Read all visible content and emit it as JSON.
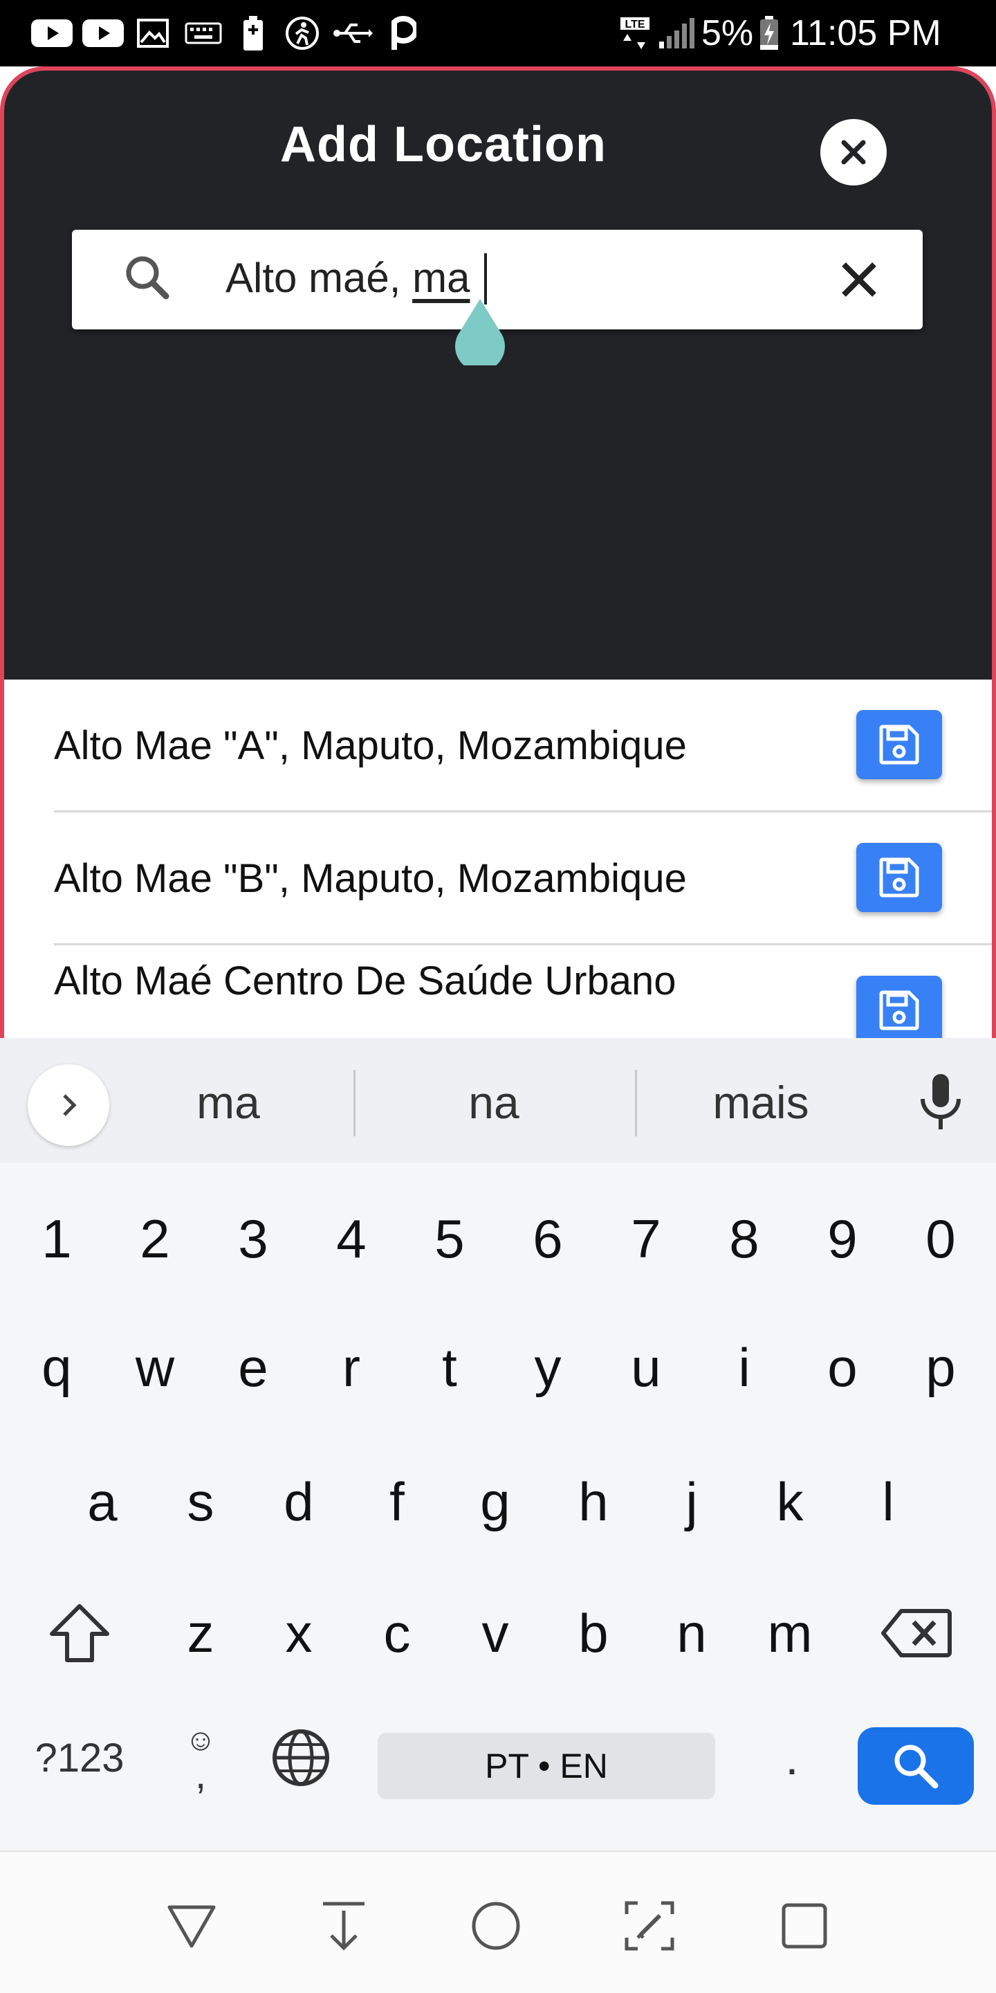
{
  "status_bar": {
    "battery_percent": "5%",
    "time": "11:05 PM",
    "network": "LTE"
  },
  "modal": {
    "title": "Add Location",
    "close_icon": "close-icon"
  },
  "search": {
    "query_prefix": "Alto maé, ",
    "query_underlined": "ma",
    "search_icon": "search-icon",
    "clear_icon": "clear-icon"
  },
  "results": [
    {
      "label": "Alto Mae \"A\", Maputo, Mozambique",
      "action_icon": "save-icon"
    },
    {
      "label": "Alto Mae \"B\", Maputo, Mozambique",
      "action_icon": "save-icon"
    },
    {
      "label": "Alto Maé Centro De Saúde Urbano",
      "action_icon": "save-icon"
    }
  ],
  "keyboard": {
    "suggestions": [
      "ma",
      "na",
      "mais"
    ],
    "number_row": [
      "1",
      "2",
      "3",
      "4",
      "5",
      "6",
      "7",
      "8",
      "9",
      "0"
    ],
    "row1": [
      "q",
      "w",
      "e",
      "r",
      "t",
      "y",
      "u",
      "i",
      "o",
      "p"
    ],
    "row2": [
      "a",
      "s",
      "d",
      "f",
      "g",
      "h",
      "j",
      "k",
      "l"
    ],
    "row3": [
      "z",
      "x",
      "c",
      "v",
      "b",
      "n",
      "m"
    ],
    "symbols_label": "?123",
    "emoji_label": "☺",
    "comma_label": ",",
    "space_label": "PT • EN",
    "period_label": "."
  },
  "colors": {
    "modal_border": "#e0435a",
    "header_bg": "#222327",
    "save_button": "#3880f5",
    "search_key": "#1a73e8",
    "caret_handle": "#7ecac4"
  }
}
